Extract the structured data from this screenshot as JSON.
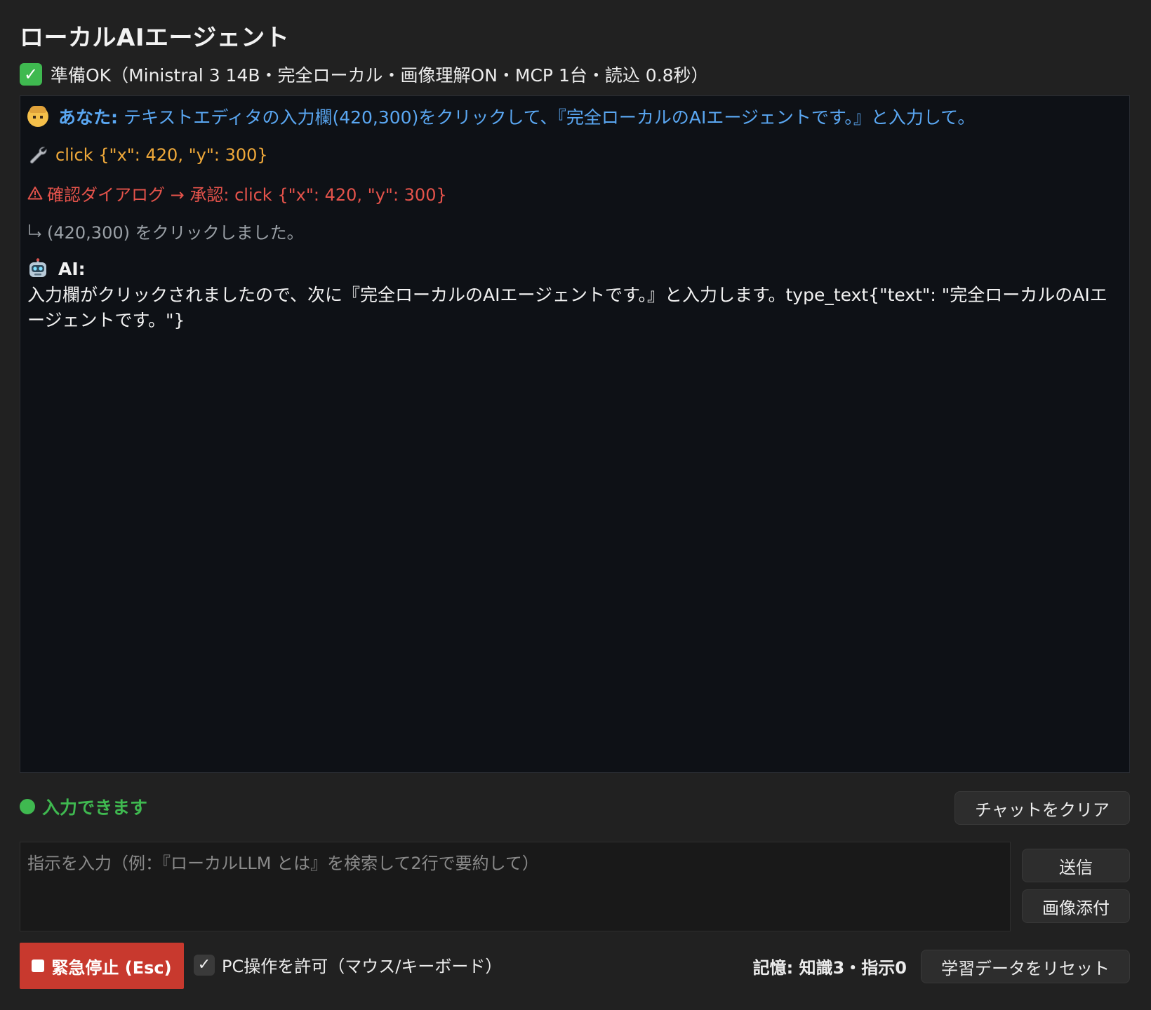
{
  "app": {
    "title": "ローカルAIエージェント",
    "status_text": "準備OK（Ministral 3 14B・完全ローカル・画像理解ON・MCP 1台・読込 0.8秒）",
    "status_icon": "check-mark-button-icon"
  },
  "chat": {
    "user": {
      "icon": "person-face-icon",
      "who": "あなた:",
      "text": " テキストエディタの入力欄(420,300)をクリックして、『完全ローカルのAIエージェントです。』と入力して。"
    },
    "tool": {
      "icon": "wrench-icon",
      "text": "click {\"x\": 420, \"y\": 300}"
    },
    "confirm": {
      "icon": "warning-icon",
      "text": "確認ダイアログ → 承認: click {\"x\": 420, \"y\": 300}"
    },
    "result": {
      "icon": "return-arrow-icon",
      "text": "(420,300) をクリックしました。"
    },
    "ai": {
      "icon": "robot-icon",
      "who": "AI:",
      "text": "入力欄がクリックされましたので、次に『完全ローカルのAIエージェントです。』と入力します。type_text{\"text\": \"完全ローカルのAIエージェントです。\"}"
    }
  },
  "input_status": "入力できます",
  "buttons": {
    "clear": "チャットをクリア",
    "send": "送信",
    "attach": "画像添付",
    "stop": "緊急停止 (Esc)",
    "reset": "学習データをリセット"
  },
  "prompt": {
    "placeholder": "指示を入力（例：『ローカルLLM とは』を検索して2行で要約して）",
    "value": ""
  },
  "allow_pc": {
    "label": "PC操作を許可（マウス/キーボード）",
    "checked": true
  },
  "memory": "記憶: 知識3・指示0",
  "colors": {
    "background": "#212121",
    "chat_bg": "#0e1116",
    "user": "#5aa7f2",
    "tool": "#f0a93a",
    "confirm": "#e5534b",
    "result": "#9aa0a6",
    "ready": "#3fb950",
    "stop": "#c8392e"
  }
}
